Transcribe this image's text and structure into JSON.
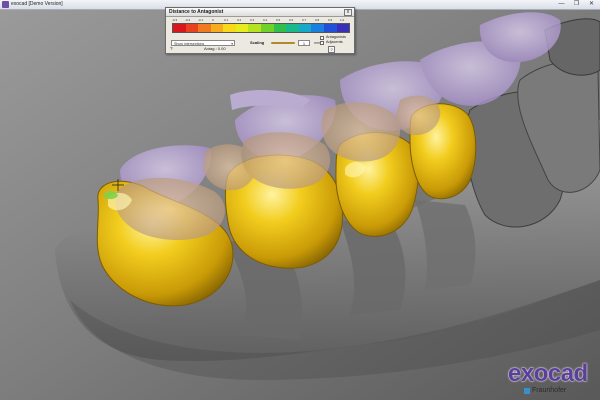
{
  "window": {
    "title": "exocad [Demo Version]",
    "controls": [
      "—",
      "❐",
      "✕"
    ]
  },
  "dialog": {
    "title": "Distance to Antagonist",
    "close_label": "x",
    "scale_labels": [
      "-0.3",
      "-0.2",
      "-0.1",
      "0",
      "0.1",
      "0.2",
      "0.3",
      "0.4",
      "0.5",
      "0.6",
      "0.7",
      "0.8",
      "0.9",
      "1.0"
    ],
    "colorbar_colors": [
      "#d8181c",
      "#e8431e",
      "#f07a1e",
      "#f5ad1c",
      "#f7d81a",
      "#e7ec1c",
      "#b7e21f",
      "#6fd12a",
      "#2fbf4a",
      "#19b98a",
      "#16a9c9",
      "#1b7fe0",
      "#2250d8",
      "#3a2fb8"
    ],
    "show_select": {
      "value": "Show intersections",
      "arrow": "▾"
    },
    "scaling": {
      "label": "Scaling",
      "value": "1",
      "unit": "mm"
    },
    "checkboxes": [
      {
        "label": "Antagonists"
      },
      {
        "label": "Adjacents"
      }
    ],
    "help_symbol": "?",
    "antag_readout": "Antag.: 0.00",
    "help2_symbol": "?"
  },
  "logo": {
    "text": "exocad",
    "sub": "Fraunhofer"
  },
  "scene": {
    "crown_color": "#e8bd12",
    "antagonist_color": "#b7a1d8",
    "gingiva_color": "#8c8c8c",
    "background_color": "#7a7a7a"
  }
}
